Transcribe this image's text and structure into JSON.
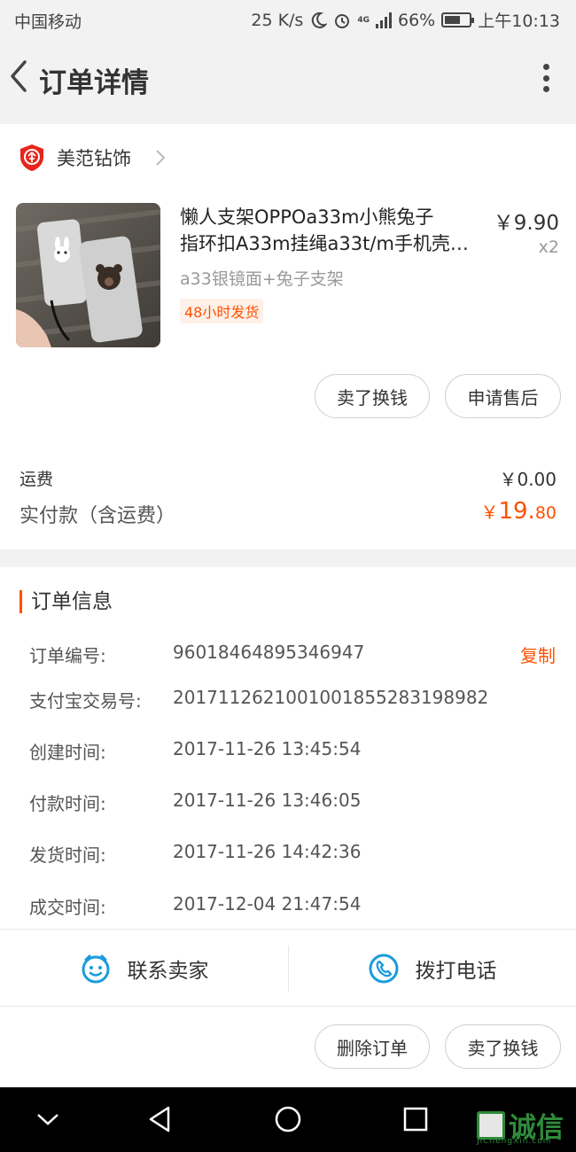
{
  "status_bar": {
    "carrier": "中国移动",
    "speed": "25 K/s",
    "network": "4G",
    "battery": "66%",
    "battery_level": 0.66,
    "time": "上午10:13"
  },
  "header": {
    "title": "订单详情"
  },
  "shop": {
    "name": "美范钻饰"
  },
  "product": {
    "title_line1": "懒人支架OPPOa33m小熊兔子",
    "title_line2": "指环扣A33m挂绳a33t/m手机壳…",
    "price": "￥9.90",
    "quantity": "x2",
    "sku": "a33银镜面+兔子支架",
    "ship_tag": "48小时发货"
  },
  "item_actions": {
    "sell": "卖了换钱",
    "after_sale": "申请售后"
  },
  "summary": {
    "shipping_label": "运费",
    "shipping_value": "￥0.00",
    "paid_label": "实付款（含运费）",
    "paid_symbol": "￥",
    "paid_int": "19.",
    "paid_dec": "80"
  },
  "order_info": {
    "title": "订单信息",
    "copy_label": "复制",
    "rows": [
      {
        "label": "订单编号:",
        "value": "96018464895346947"
      },
      {
        "label": "支付宝交易号:",
        "value": "2017112621001001855283198982"
      },
      {
        "label": "创建时间:",
        "value": "2017-11-26 13:45:54"
      },
      {
        "label": "付款时间:",
        "value": "2017-11-26 13:46:05"
      },
      {
        "label": "发货时间:",
        "value": "2017-11-26 14:42:36"
      },
      {
        "label": "成交时间:",
        "value": "2017-12-04 21:47:54"
      }
    ]
  },
  "contact": {
    "seller": "联系卖家",
    "call": "拨打电话"
  },
  "bottom_actions": {
    "delete": "删除订单",
    "sell": "卖了换钱"
  },
  "watermark": {
    "text": "诚信",
    "sub": "JiChengXin.com"
  },
  "colors": {
    "accent": "#ff5000",
    "icon_blue": "#1a9cde"
  }
}
